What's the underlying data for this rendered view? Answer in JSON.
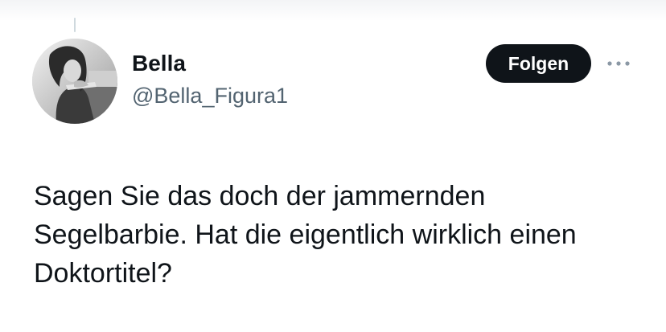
{
  "tweet": {
    "author": {
      "display_name": "Bella",
      "handle": "@Bella_Figura1",
      "avatar_icon": "profile-photo"
    },
    "follow_label": "Folgen",
    "more_icon": "more-horizontal-icon",
    "text": "Sagen Sie das doch der jammernden Segelbarbie. Hat die eigentlich wirklich einen Doktortitel?"
  },
  "colors": {
    "text_primary": "#0f1419",
    "text_secondary": "#536471",
    "follow_button_bg": "#0f1419",
    "follow_button_text": "#ffffff",
    "background": "#ffffff"
  }
}
